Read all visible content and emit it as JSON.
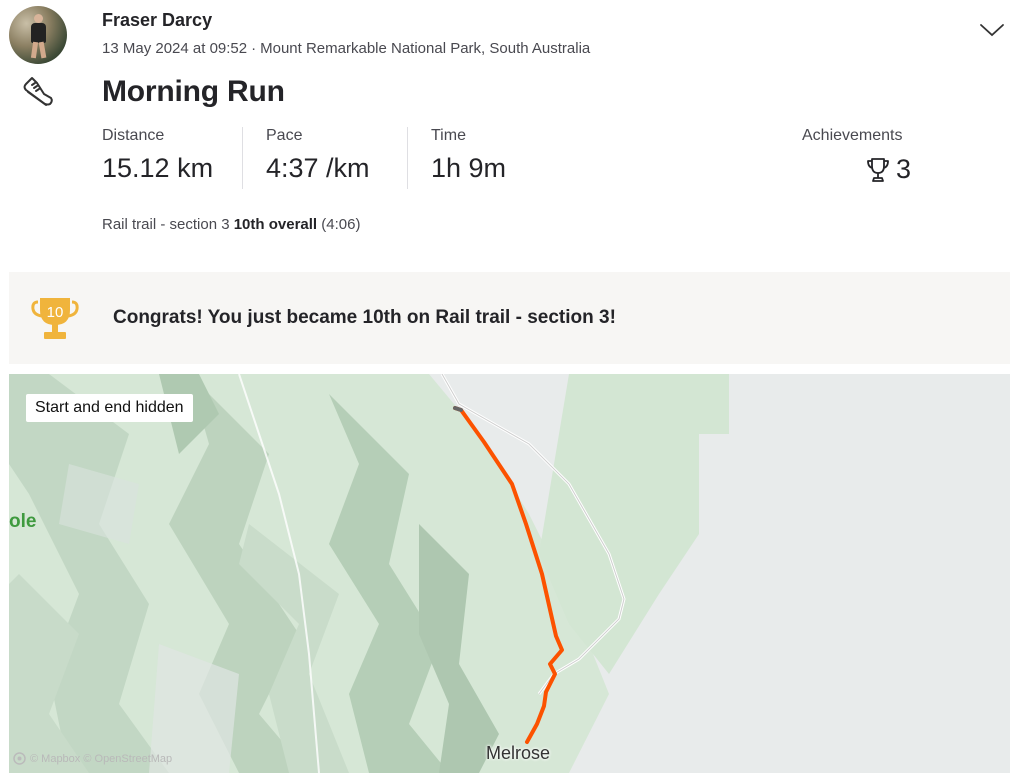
{
  "athlete": {
    "name": "Fraser Darcy"
  },
  "activity": {
    "date_time": "13 May 2024 at 09:52",
    "separator": "·",
    "location": "Mount Remarkable National Park, South Australia",
    "title": "Morning Run",
    "sport_icon": "shoe-icon"
  },
  "stats": [
    {
      "label": "Distance",
      "value": "15.12 km"
    },
    {
      "label": "Pace",
      "value": "4:37 /km"
    },
    {
      "label": "Time",
      "value": "1h 9m"
    }
  ],
  "achievements": {
    "label": "Achievements",
    "count": "3",
    "icon": "trophy-icon"
  },
  "segment": {
    "name": "Rail trail - section 3",
    "rank": "10th overall",
    "time": "(4:06)"
  },
  "banner": {
    "trophy_number": "10",
    "text": "Congrats! You just became 10th on Rail trail - section 3!",
    "color": "#f0b43c"
  },
  "map": {
    "badge": "Start and end hidden",
    "place_left": "ole",
    "place_town": "Melrose",
    "attribution": "© Mapbox © OpenStreetMap",
    "route_color": "#fc5200"
  }
}
